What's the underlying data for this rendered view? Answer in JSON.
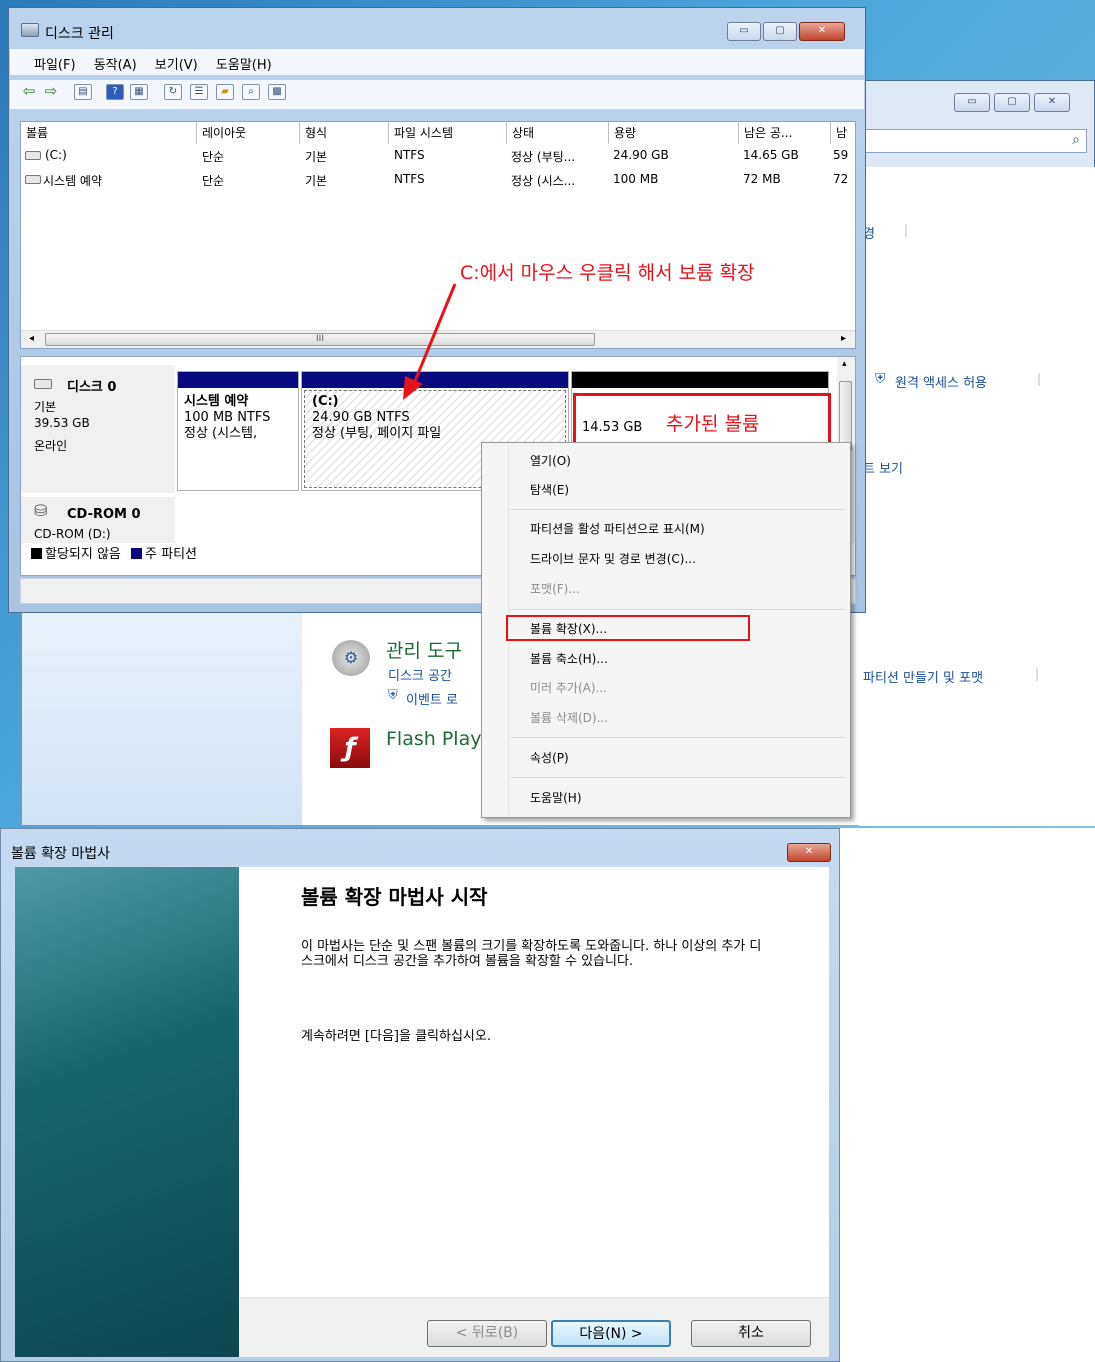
{
  "disk_mgmt": {
    "title": "디스크 관리",
    "menu": [
      "파일(F)",
      "동작(A)",
      "보기(V)",
      "도움말(H)"
    ],
    "toolbar_icons": [
      "back-icon",
      "forward-icon",
      "console-tree-icon",
      "help-icon",
      "details-icon",
      "refresh-icon",
      "properties-icon",
      "open-icon",
      "search-icon",
      "settings-icon"
    ],
    "columns": [
      "볼륨",
      "레이아웃",
      "형식",
      "파일 시스템",
      "상태",
      "용량",
      "남은 공...",
      "남"
    ],
    "rows": [
      [
        "(C:)",
        "단순",
        "기본",
        "NTFS",
        "정상 (부팅...",
        "24.90 GB",
        "14.65 GB",
        "59"
      ],
      [
        "시스템 예약",
        "단순",
        "기본",
        "NTFS",
        "정상 (시스...",
        "100 MB",
        "72 MB",
        "72"
      ]
    ],
    "hscroll_glyph": "III",
    "disk0": {
      "name": "디스크 0",
      "type": "기본",
      "size": "39.53 GB",
      "status": "온라인"
    },
    "partitions": [
      {
        "name": "시스템 예약",
        "detail": "100 MB NTFS",
        "status": "정상 (시스템,"
      },
      {
        "name": "(C:)",
        "detail": "24.90 GB NTFS",
        "status": "정상 (부팅, 페이지 파일"
      },
      {
        "size": "14.53 GB"
      }
    ],
    "cdrom": {
      "name": "CD-ROM 0",
      "label": "CD-ROM (D:)"
    },
    "legend": [
      "할당되지 않음",
      "주 파티션"
    ],
    "colors": {
      "primary_partition": "#0a0a80",
      "unallocated": "#000000",
      "annotation": "#e8121b"
    }
  },
  "annotations": {
    "instruction": "C:에서 마우스 우클릭 해서 보륨 확장",
    "added_volume": "추가된 볼륨"
  },
  "context_menu": {
    "items": [
      {
        "label": "열기(O)",
        "enabled": true
      },
      {
        "label": "탐색(E)",
        "enabled": true
      },
      {
        "label": "파티션을 활성 파티션으로 표시(M)",
        "enabled": true
      },
      {
        "label": "드라이브 문자 및 경로 변경(C)...",
        "enabled": true
      },
      {
        "label": "포맷(F)...",
        "enabled": false
      },
      {
        "label": "볼륨 확장(X)...",
        "enabled": true,
        "highlighted": true
      },
      {
        "label": "볼륨 축소(H)...",
        "enabled": true
      },
      {
        "label": "미러 추가(A)...",
        "enabled": false
      },
      {
        "label": "볼륨 삭제(D)...",
        "enabled": false
      },
      {
        "label": "속성(P)",
        "enabled": true
      },
      {
        "label": "도움말(H)",
        "enabled": true
      }
    ]
  },
  "background_panel": {
    "link_change": "경",
    "remote_access": "원격 액세스 허용",
    "view_link": "트 보기",
    "admin_tools_title": "관리 도구",
    "admin_disk": "디스크 공간",
    "admin_event": "이벤트 로",
    "partition_create": "파티션 만들기 및 포맷",
    "flash": "Flash Play"
  },
  "wizard": {
    "title": "볼륨 확장 마법사",
    "heading": "볼륨 확장 마법사 시작",
    "description": "이 마법사는 단순 및 스팬 볼륨의 크기를 확장하도록 도와줍니다. 하나 이상의 추가 디스크에서 디스크 공간을 추가하여 볼륨을 확장할 수 있습니다.",
    "continue_text": "계속하려면 [다음]을 클릭하십시오.",
    "buttons": {
      "back": "< 뒤로(B)",
      "next": "다음(N) >",
      "cancel": "취소"
    }
  }
}
